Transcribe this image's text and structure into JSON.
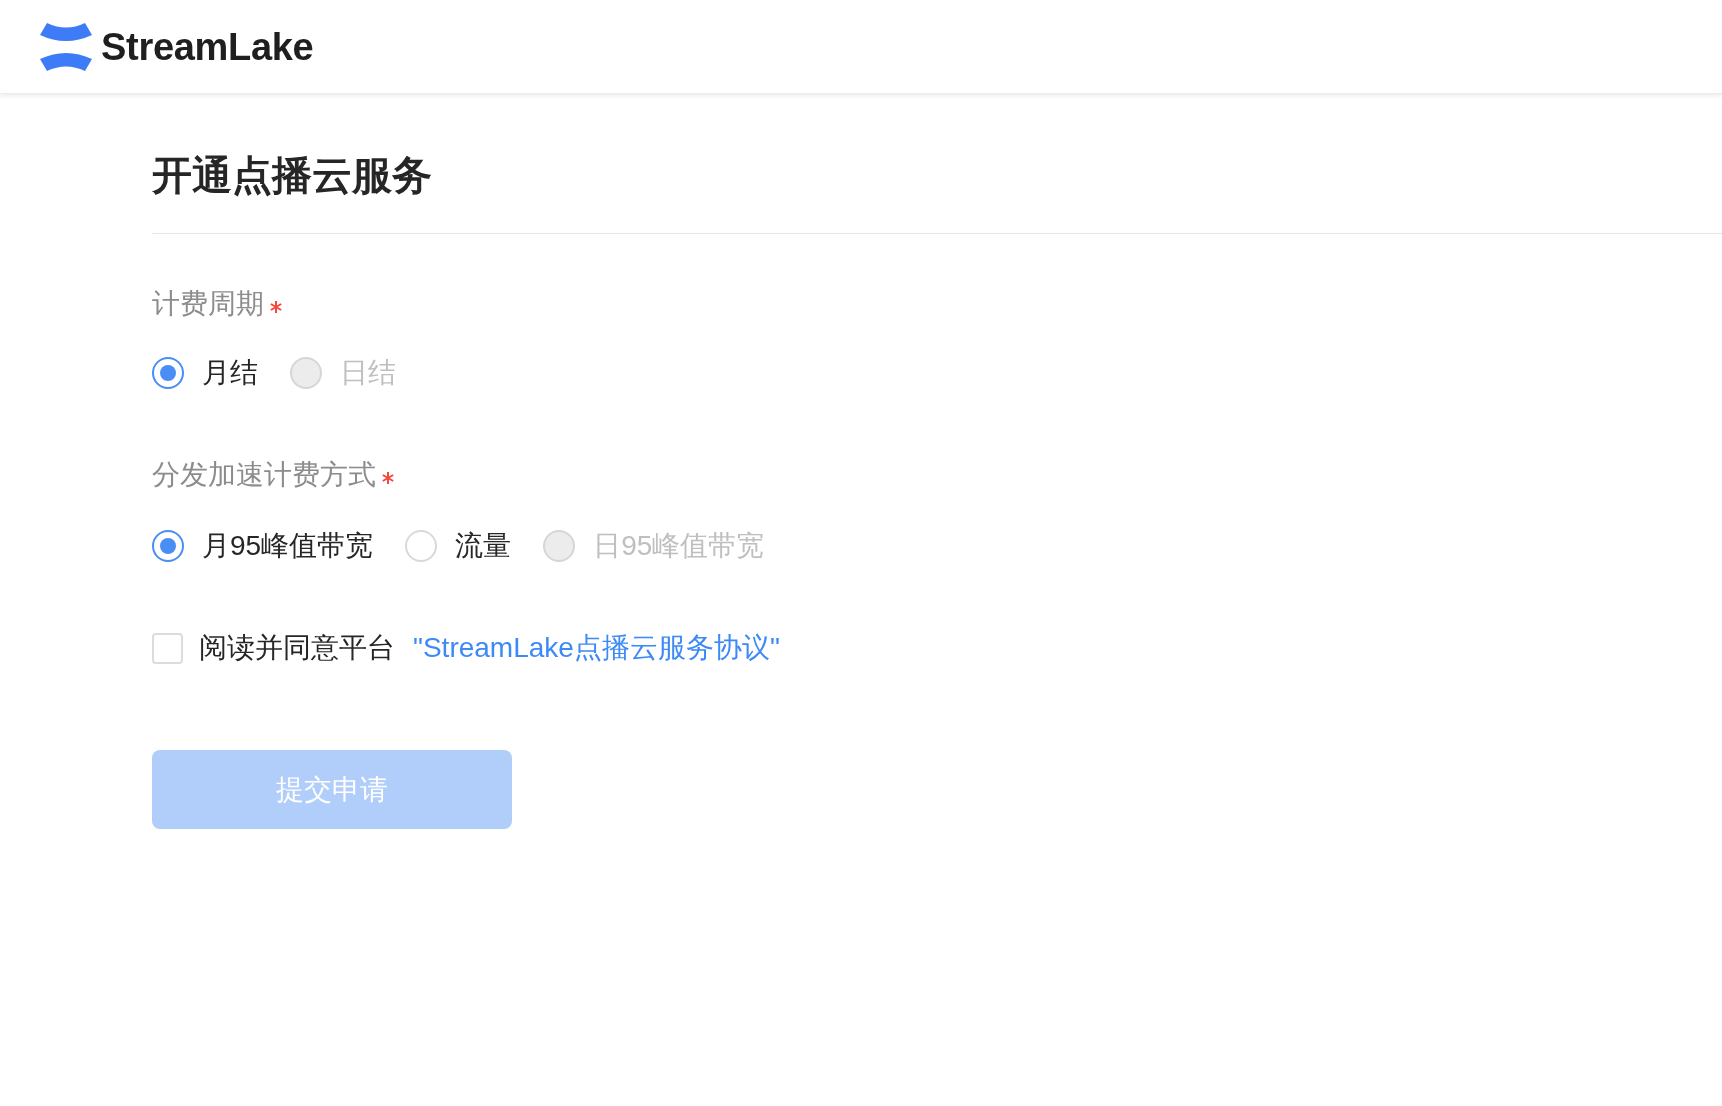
{
  "header": {
    "logo_text": "StreamLake"
  },
  "title": "开通点播云服务",
  "fields": [
    {
      "label": "计费周期",
      "required": true,
      "options": [
        {
          "label": "月结",
          "selected": true,
          "disabled": false
        },
        {
          "label": "日结",
          "selected": false,
          "disabled": true
        }
      ]
    },
    {
      "label": "分发加速计费方式",
      "required": true,
      "options": [
        {
          "label": "月95峰值带宽",
          "selected": true,
          "disabled": false
        },
        {
          "label": "流量",
          "selected": false,
          "disabled": false
        },
        {
          "label": "日95峰值带宽",
          "selected": false,
          "disabled": true
        }
      ]
    }
  ],
  "agreement": {
    "checked": false,
    "text": "阅读并同意平台",
    "link": "\"StreamLake点播云服务协议\""
  },
  "submit_button": {
    "label": "提交申请",
    "disabled": true
  }
}
